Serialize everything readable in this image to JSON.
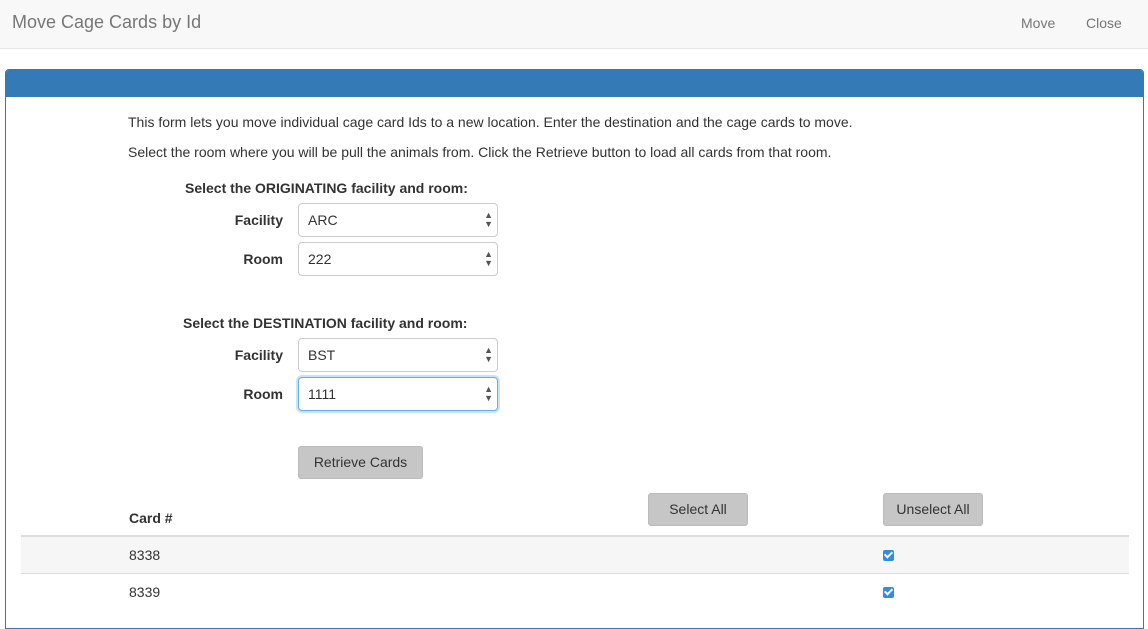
{
  "navbar": {
    "title": "Move Cage Cards by Id",
    "move_label": "Move",
    "close_label": "Close"
  },
  "instructions": {
    "line1": "This form lets you move individual cage card Ids to a new location. Enter the destination and the cage cards to move.",
    "line2": "Select the room where you will be pull the animals from. Click the Retrieve button to load all cards from that room."
  },
  "originating": {
    "heading": "Select the ORIGINATING facility and room:",
    "facility_label": "Facility",
    "facility_value": "ARC",
    "room_label": "Room",
    "room_value": "222"
  },
  "destination": {
    "heading": "Select the DESTINATION facility and room:",
    "facility_label": "Facility",
    "facility_value": "BST",
    "room_label": "Room",
    "room_value": "1111"
  },
  "actions": {
    "retrieve_label": "Retrieve Cards",
    "select_all_label": "Select All",
    "unselect_all_label": "Unselect All"
  },
  "table": {
    "header_card": "Card #",
    "rows": [
      {
        "card": "8338",
        "checked": true
      },
      {
        "card": "8339",
        "checked": true
      }
    ]
  },
  "colors": {
    "panel_heading": "#337ab7",
    "checkbox": "#2e8ee6",
    "button": "#c6c6c6"
  },
  "icons": {
    "select_arrow": "up-down-chevron-icon",
    "checkbox": "checkmark-icon"
  }
}
